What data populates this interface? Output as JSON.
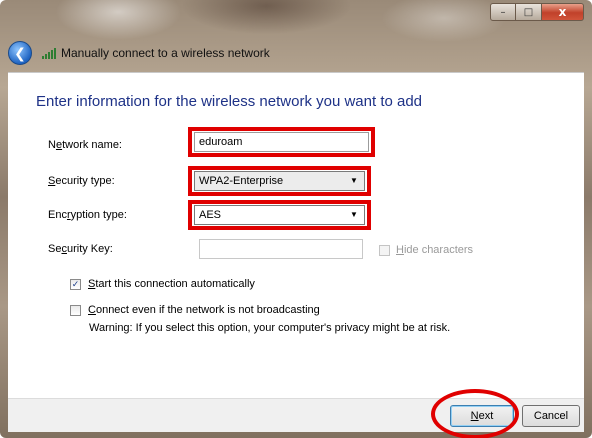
{
  "window": {
    "title": "Manually connect to a wireless network",
    "caption": {
      "minimize": "–",
      "maximize": "□",
      "close": "x"
    }
  },
  "heading": "Enter information for the wireless network you want to add",
  "form": {
    "network_name": {
      "label_pre": "N",
      "label_key": "e",
      "label_post": "twork name:",
      "value": "eduroam"
    },
    "security_type": {
      "label_key": "S",
      "label_post": "ecurity type:",
      "value": "WPA2-Enterprise"
    },
    "encryption_type": {
      "label_pre": "Enc",
      "label_key": "r",
      "label_post": "yption type:",
      "value": "AES"
    },
    "security_key": {
      "label_pre": "Se",
      "label_key": "c",
      "label_post": "urity Key:",
      "value": ""
    },
    "hide_characters": {
      "label_key": "H",
      "label_post": "ide characters",
      "checked": false
    }
  },
  "options": {
    "start_auto": {
      "label_key": "S",
      "label_post": "tart this connection automatically",
      "checked": true
    },
    "connect_hidden": {
      "label_key": "C",
      "label_post": "onnect even if the network is not broadcasting",
      "checked": false
    },
    "warning": "Warning: If you select this option, your computer's privacy might be at risk."
  },
  "buttons": {
    "next_key": "N",
    "next_post": "ext",
    "cancel": "Cancel"
  },
  "colors": {
    "highlight": "#e00000",
    "heading": "#1e3287"
  },
  "icons": {
    "back": "back-arrow-icon",
    "network": "wireless-signal-icon",
    "dropdown": "chevron-down-icon"
  }
}
